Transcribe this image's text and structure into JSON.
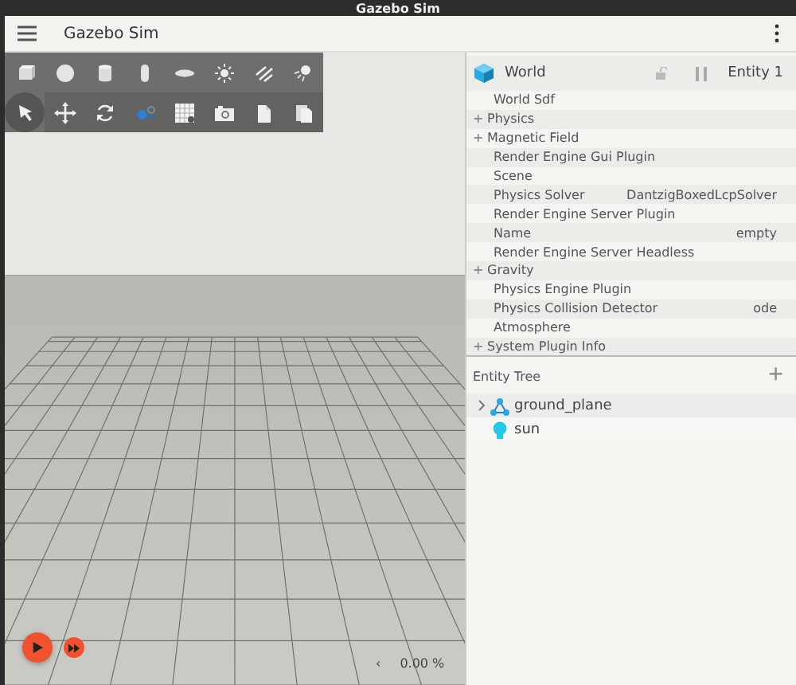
{
  "window": {
    "title": "Gazebo Sim"
  },
  "app_bar": {
    "title": "Gazebo Sim"
  },
  "toolbar": [
    {
      "kind": "box",
      "selected": false
    },
    {
      "kind": "sphere",
      "selected": false
    },
    {
      "kind": "cylinder",
      "selected": false
    },
    {
      "kind": "capsule",
      "selected": false
    },
    {
      "kind": "ellipsoid",
      "selected": false
    },
    {
      "kind": "sun",
      "selected": false
    },
    {
      "kind": "spot",
      "selected": false
    },
    {
      "kind": "point",
      "selected": false
    },
    {
      "kind": "select",
      "selected": true
    },
    {
      "kind": "move",
      "selected": false
    },
    {
      "kind": "rotate",
      "selected": false
    },
    {
      "kind": "transform",
      "selected": false
    },
    {
      "kind": "grid",
      "selected": false
    },
    {
      "kind": "camera",
      "selected": false
    },
    {
      "kind": "copy",
      "selected": false
    },
    {
      "kind": "paste",
      "selected": false
    }
  ],
  "playback": {
    "playing": false,
    "rate": "0.00 %",
    "rate_arrow": "‹"
  },
  "component_inspector": {
    "name": "World",
    "entity": "Entity 1",
    "locked": false,
    "paused": true,
    "rows": [
      {
        "label": "World Sdf"
      },
      {
        "label": "Physics",
        "expander": "+"
      },
      {
        "label": "Magnetic Field",
        "expander": "+"
      },
      {
        "label": "Render Engine Gui Plugin"
      },
      {
        "label": "Scene"
      },
      {
        "label": "Physics Solver",
        "value": "DantzigBoxedLcpSolver"
      },
      {
        "label": "Render Engine Server Plugin"
      },
      {
        "label": "Name",
        "value": "empty"
      },
      {
        "label": "Render Engine Server Headless"
      },
      {
        "label": "Gravity",
        "expander": "+"
      },
      {
        "label": "Physics Engine Plugin"
      },
      {
        "label": "Physics Collision Detector",
        "value": "ode"
      },
      {
        "label": "Atmosphere"
      },
      {
        "label": "System Plugin Info",
        "expander": "+"
      }
    ]
  },
  "entity_tree": {
    "title": "Entity Tree",
    "add": "+",
    "items": [
      {
        "name": "ground_plane",
        "kind": "model",
        "expandable": true
      },
      {
        "name": "sun",
        "kind": "light",
        "expandable": false
      }
    ]
  }
}
